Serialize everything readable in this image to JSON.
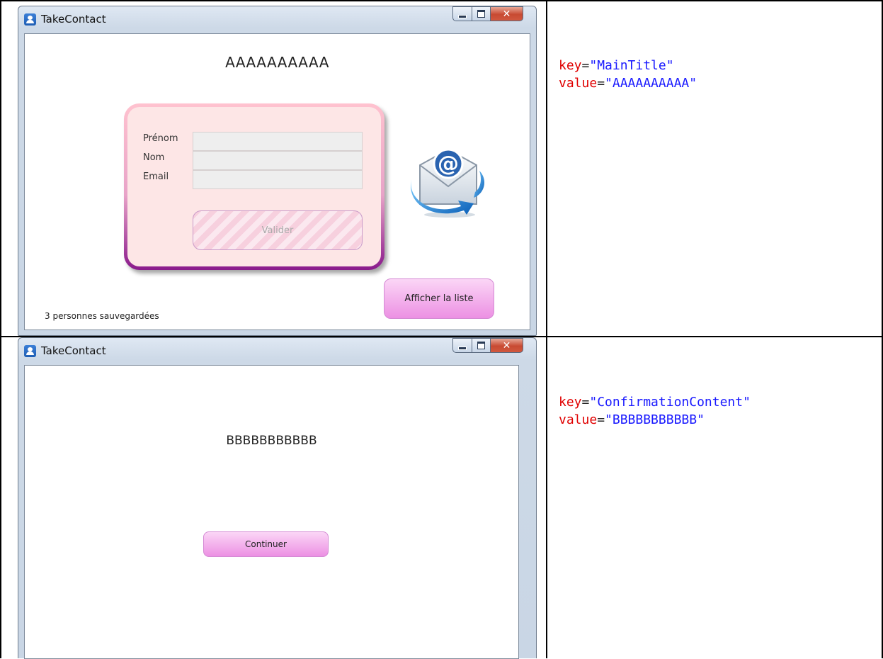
{
  "rows": [
    {
      "window": {
        "title": "TakeContact",
        "main_title": "AAAAAAAAAA",
        "form": {
          "fields": [
            {
              "label": "Prénom",
              "value": ""
            },
            {
              "label": "Nom",
              "value": ""
            },
            {
              "label": "Email",
              "value": ""
            }
          ],
          "submit_label": "Valider"
        },
        "status_text": "3 personnes sauvegardées",
        "list_button_label": "Afficher la liste"
      },
      "annotation": {
        "key_word": "key",
        "key_value": "\"MainTitle\"",
        "value_word": "value",
        "value_value": "\"AAAAAAAAAA\""
      }
    },
    {
      "window": {
        "title": "TakeContact",
        "confirmation_text": "BBBBBBBBBBB",
        "continue_button_label": "Continuer"
      },
      "annotation": {
        "key_word": "key",
        "key_value": "\"ConfirmationContent\"",
        "value_word": "value",
        "value_value": "\"BBBBBBBBBBB\""
      }
    }
  ],
  "icons": {
    "app": "contact-app-icon",
    "email": "email-at-envelope-icon",
    "minimize": "minimize-icon",
    "maximize": "maximize-icon",
    "close": "close-icon"
  },
  "colors": {
    "annotation_key": "#e00000",
    "annotation_value": "#1a1aff",
    "button_pink": "#ec90e3",
    "card_background": "#fde6e6",
    "card_border_bottom": "#8a1a8c"
  }
}
